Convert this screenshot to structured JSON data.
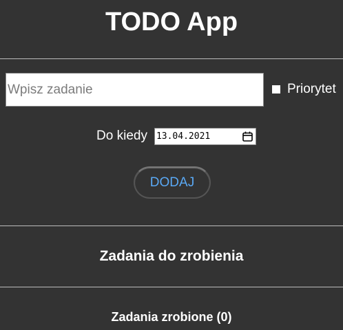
{
  "app": {
    "title": "TODO App"
  },
  "form": {
    "task_placeholder": "Wpisz zadanie",
    "task_value": "",
    "priority_label": "Priorytet",
    "priority_checked": false,
    "deadline_label": "Do kiedy",
    "deadline_value": "13.04.2021",
    "add_button_label": "DODAJ"
  },
  "sections": {
    "todo_title": "Zadania do zrobienia",
    "done_title": "Zadania zrobione (0)"
  },
  "colors": {
    "background": "#333333",
    "text": "#ffffff",
    "accent": "#5aa9f5",
    "divider": "#bdbdbd"
  },
  "icons": {
    "date_picker": "calendar-icon"
  }
}
